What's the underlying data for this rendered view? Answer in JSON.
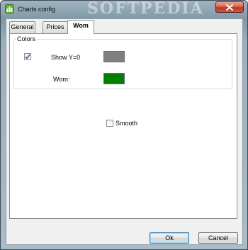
{
  "window": {
    "title": "Charts config",
    "watermark": "SOFTPEDIA",
    "icon": "chart-app-icon",
    "close_icon": "close-icon"
  },
  "tabs": [
    {
      "label": "General",
      "active": false
    },
    {
      "label": "Prices",
      "active": false
    },
    {
      "label": "Wom",
      "active": true
    }
  ],
  "colors_group": {
    "title": "Colors",
    "show_y0": {
      "label": "Show Y=0",
      "checked": true,
      "color": "#808080"
    },
    "wom": {
      "label": "Wom:",
      "color": "#008000"
    }
  },
  "smooth": {
    "label": "Smooth",
    "checked": false
  },
  "buttons": {
    "ok": "Ok",
    "cancel": "Cancel"
  }
}
